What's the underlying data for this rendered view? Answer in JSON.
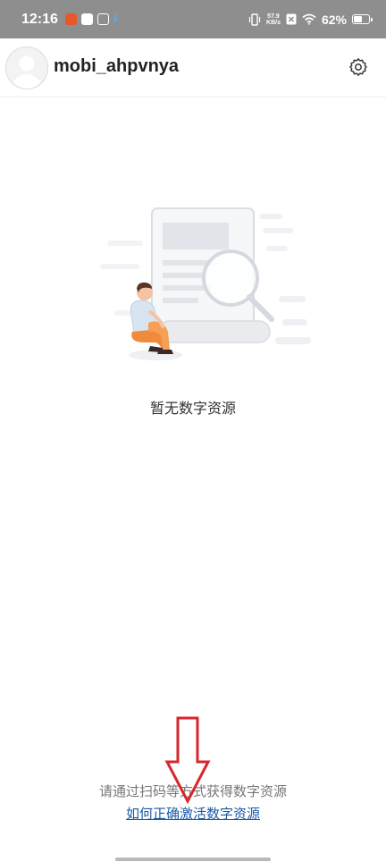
{
  "status_bar": {
    "time": "12:16",
    "net_speed_value": "57.9",
    "net_speed_unit": "KB/s",
    "battery_percent": "62%",
    "battery_level": 0.62,
    "icons": [
      "app-notification-icon",
      "app-notification-icon",
      "app-notification-icon",
      "download-icon",
      "vibrate-icon",
      "sim-off-icon",
      "wifi-icon",
      "battery-icon"
    ]
  },
  "header": {
    "username": "mobi_ahpvnya",
    "avatar_icon": "avatar-placeholder-icon",
    "settings_icon": "gear-icon"
  },
  "empty_state": {
    "illustration_icon": "empty-search-illustration",
    "message": "暂无数字资源"
  },
  "footer": {
    "hint": "请通过扫码等方式获得数字资源",
    "help_link": "如何正确激活数字资源",
    "annotation_icon": "red-arrow-down-icon"
  },
  "colors": {
    "status_bar_bg": "#8e8e8e",
    "link": "#1a5aa6",
    "annotation_arrow": "#d9262c",
    "figure_orange": "#f28a3c"
  }
}
